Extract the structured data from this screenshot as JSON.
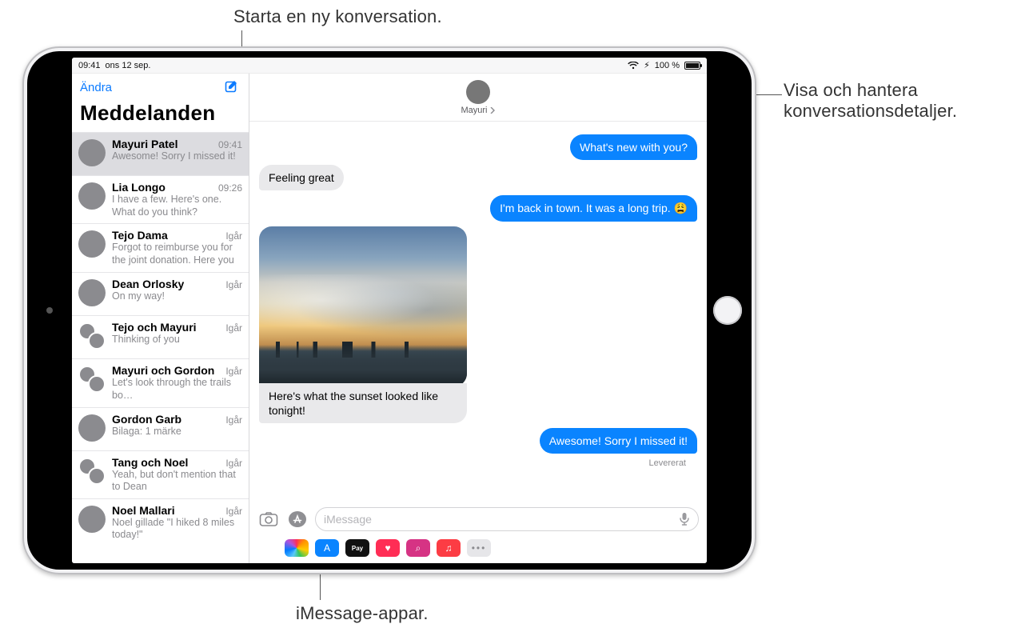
{
  "callouts": {
    "top": "Starta en ny konversation.",
    "right": "Visa och hantera konversationsdetaljer.",
    "bottom": "iMessage-appar."
  },
  "statusbar": {
    "time": "09:41",
    "date": "ons 12 sep.",
    "battery_pct": "100 %",
    "charging_glyph": "⚡︎"
  },
  "sidebar": {
    "edit": "Ändra",
    "title": "Meddelanden",
    "items": [
      {
        "name": "Mayuri Patel",
        "time": "09:41",
        "preview": "Awesome! Sorry I missed it!",
        "selected": true,
        "group": false
      },
      {
        "name": "Lia Longo",
        "time": "09:26",
        "preview": "I have a few. Here's one. What do you think?",
        "selected": false,
        "group": false
      },
      {
        "name": "Tejo Dama",
        "time": "Igår",
        "preview": "Forgot to reimburse you for the joint donation. Here you go…",
        "selected": false,
        "group": false
      },
      {
        "name": "Dean Orlosky",
        "time": "Igår",
        "preview": "On my way!",
        "selected": false,
        "group": false
      },
      {
        "name": "Tejo och Mayuri",
        "time": "Igår",
        "preview": "Thinking of you",
        "selected": false,
        "group": true
      },
      {
        "name": "Mayuri och Gordon",
        "time": "Igår",
        "preview": "Let's look through the trails bo…",
        "selected": false,
        "group": true
      },
      {
        "name": "Gordon Garb",
        "time": "Igår",
        "preview": "Bilaga: 1 märke",
        "selected": false,
        "group": false
      },
      {
        "name": "Tang och Noel",
        "time": "Igår",
        "preview": "Yeah, but don't mention that to Dean",
        "selected": false,
        "group": true
      },
      {
        "name": "Noel Mallari",
        "time": "Igår",
        "preview": "Noel gillade \"I hiked 8 miles today!\"",
        "selected": false,
        "group": false
      }
    ]
  },
  "conversation": {
    "contact_name": "Mayuri",
    "messages": [
      {
        "role": "sent",
        "text": "What's new with you?"
      },
      {
        "role": "recv",
        "text": "Feeling great"
      },
      {
        "role": "sent",
        "text": "I'm back in town. It was a long trip. 😩"
      },
      {
        "role": "recv_image_caption",
        "text": "Here's what the sunset looked like tonight!"
      },
      {
        "role": "sent",
        "text": "Awesome! Sorry I missed it!"
      }
    ],
    "delivered_label": "Levererat"
  },
  "input": {
    "placeholder": "iMessage"
  },
  "app_strip": {
    "apps": [
      {
        "id": "photos",
        "label": ""
      },
      {
        "id": "store",
        "label": "A"
      },
      {
        "id": "pay",
        "label": "Pay"
      },
      {
        "id": "heart",
        "label": "♥"
      },
      {
        "id": "search",
        "label": "⌕"
      },
      {
        "id": "music",
        "label": "♫"
      },
      {
        "id": "more",
        "label": "•••"
      }
    ]
  }
}
